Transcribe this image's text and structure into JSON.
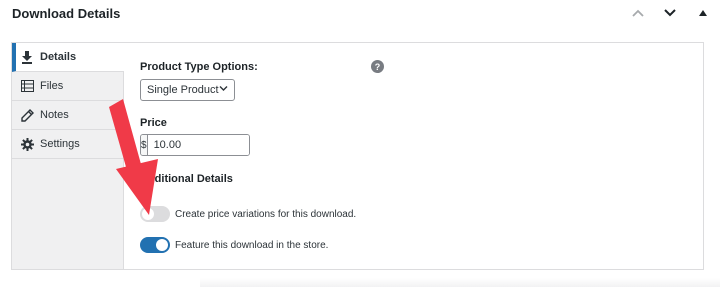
{
  "panel": {
    "title": "Download Details",
    "controls": [
      "move-up",
      "move-down",
      "toggle-panel"
    ]
  },
  "tabs": [
    {
      "label": "Details",
      "icon": "download-icon",
      "active": true
    },
    {
      "label": "Files",
      "icon": "list-icon",
      "active": false
    },
    {
      "label": "Notes",
      "icon": "pencil-icon",
      "active": false
    },
    {
      "label": "Settings",
      "icon": "gear-icon",
      "active": false
    }
  ],
  "details": {
    "product_type_label": "Product Type Options:",
    "help_glyph": "?",
    "product_type_value": "Single Product",
    "price_label": "Price",
    "currency_symbol": "$",
    "price_value": "10.00",
    "additional_label": "Additional Details",
    "toggles": [
      {
        "label": "Create price variations for this download.",
        "on": false
      },
      {
        "label": "Feature this download in the store.",
        "on": true
      }
    ]
  },
  "colors": {
    "accent": "#2271b1",
    "annotation_arrow": "#f03a48",
    "tab_bg": "#f0f0f1",
    "border": "#dcdcde"
  }
}
